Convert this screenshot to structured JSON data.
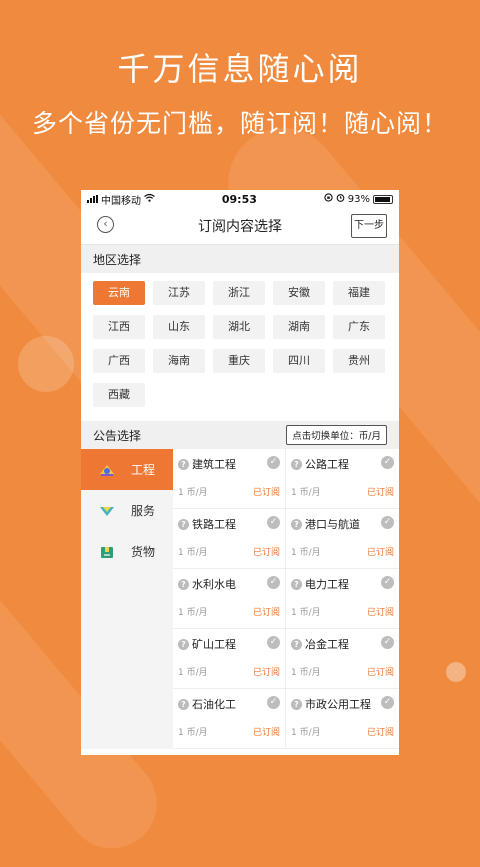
{
  "banner": {
    "title": "千万信息随心阅",
    "subtitle": "多个省份无门槛，随订阅！随心阅！"
  },
  "status_bar": {
    "carrier": "中国移动",
    "time": "09:53",
    "battery": "93%"
  },
  "nav": {
    "title": "订阅内容选择",
    "next_label": "下一步"
  },
  "region_section": {
    "title": "地区选择",
    "regions": [
      "云南",
      "江苏",
      "浙江",
      "安徽",
      "福建",
      "江西",
      "山东",
      "湖北",
      "湖南",
      "广东",
      "广西",
      "海南",
      "重庆",
      "四川",
      "贵州",
      "西藏"
    ],
    "selected": "云南"
  },
  "announce_section": {
    "title": "公告选择",
    "unit_toggle": "点击切换单位：币/月"
  },
  "categories": [
    {
      "label": "工程",
      "icon": "engineering-icon"
    },
    {
      "label": "服务",
      "icon": "service-icon"
    },
    {
      "label": "货物",
      "icon": "goods-icon"
    }
  ],
  "items": [
    {
      "name": "建筑工程",
      "price": "1 币/月",
      "status": "已订阅"
    },
    {
      "name": "公路工程",
      "price": "1 币/月",
      "status": "已订阅"
    },
    {
      "name": "铁路工程",
      "price": "1 币/月",
      "status": "已订阅"
    },
    {
      "name": "港口与航道",
      "price": "1 币/月",
      "status": "已订阅"
    },
    {
      "name": "水利水电",
      "price": "1 币/月",
      "status": "已订阅"
    },
    {
      "name": "电力工程",
      "price": "1 币/月",
      "status": "已订阅"
    },
    {
      "name": "矿山工程",
      "price": "1 币/月",
      "status": "已订阅"
    },
    {
      "name": "冶金工程",
      "price": "1 币/月",
      "status": "已订阅"
    },
    {
      "name": "石油化工",
      "price": "1 币/月",
      "status": "已订阅"
    },
    {
      "name": "市政公用工程",
      "price": "1 币/月",
      "status": "已订阅"
    }
  ],
  "colors": {
    "accent": "#EE7733",
    "background": "#F08A3E"
  }
}
